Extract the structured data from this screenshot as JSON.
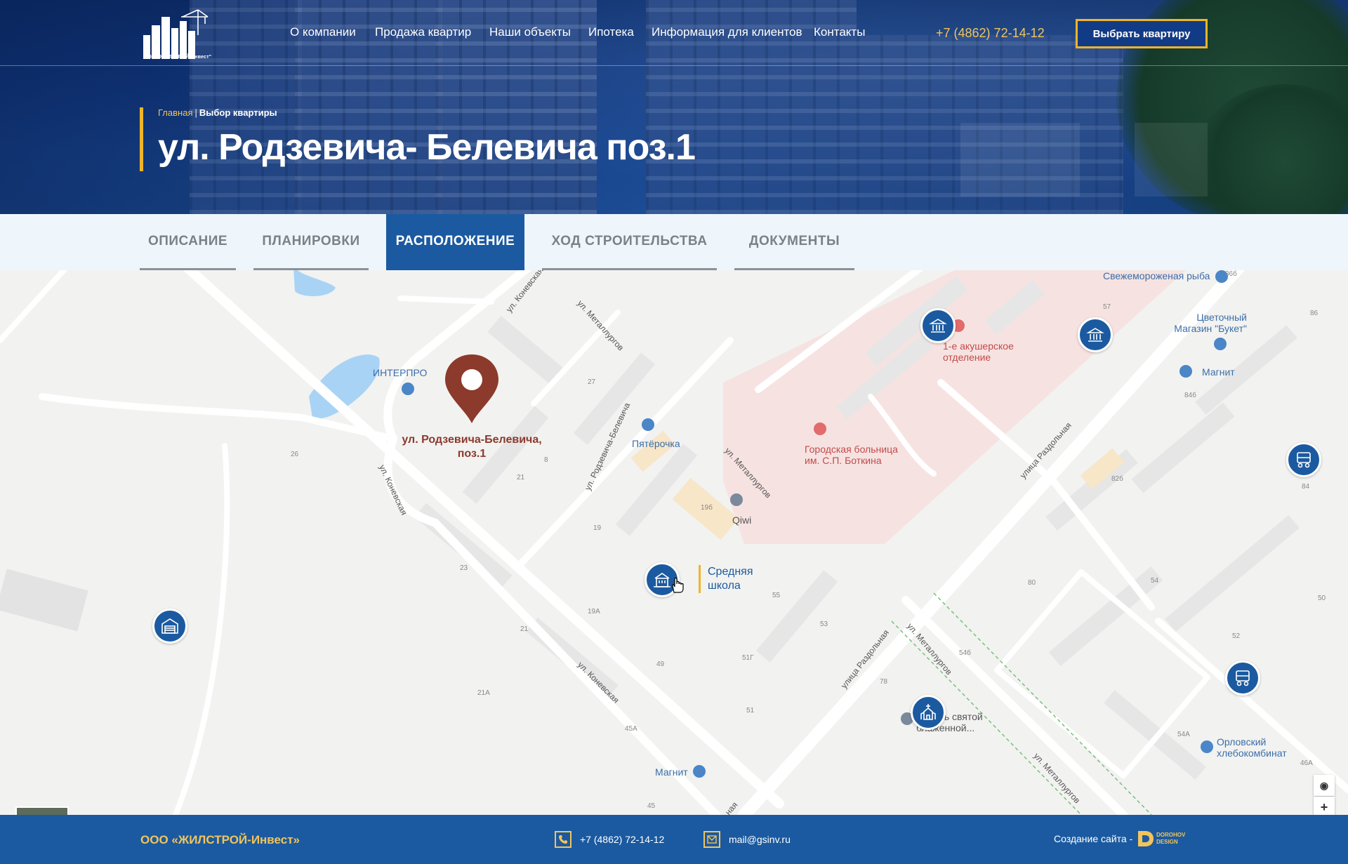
{
  "header": {
    "logo_text": "ООО \"ЖИЛСТРОЙ-Инвест\"",
    "nav": [
      "О компании",
      "Продажа квартир",
      "Наши объекты",
      "Ипотека",
      "Информация для клиентов",
      "Контакты"
    ],
    "phone": "+7 (4862) 72-14-12",
    "cta_label": "Выбрать квартиру"
  },
  "breadcrumb": {
    "home": "Главная",
    "separator": "|",
    "current": "Выбор квартиры"
  },
  "page_title": "ул. Родзевича- Белевича поз.1",
  "tabs": [
    {
      "label": "ОПИСАНИЕ",
      "active": false
    },
    {
      "label": "ПЛАНИРОВКИ",
      "active": false
    },
    {
      "label": "РАСПОЛОЖЕНИЕ",
      "active": true
    },
    {
      "label": "ХОД СТРОИТЕЛЬСТВА",
      "active": false
    },
    {
      "label": "ДОКУМЕНТЫ",
      "active": false
    }
  ],
  "map": {
    "main_marker_label": "ул. Родзевича-Белевича, поз.1",
    "school_label": "Средняя школа",
    "pois": {
      "interpro": "ИНТЕРПРО",
      "pyaterochka": "Пятёрочка",
      "qiwi": "Qiwi",
      "hospital": "Городская больница им. С.П. Боткина",
      "maternity": "1-е акушерское отделение",
      "fish": "Свежемороженая рыба",
      "flowers": "Цветочный Магазин \"Букет\"",
      "magnit_top": "Магнит",
      "magnit_bottom": "Магнит",
      "church": "в честь святой блаженной...",
      "bakery": "Орловский хлебокомбинат"
    },
    "streets": {
      "konevskaya_1": "ул. Коневская",
      "konevskaya_2": "ул. Коневская",
      "konevskaya_3": "ул. Коневская",
      "metallurgov_1": "ул. Металлургов",
      "metallurgov_2": "ул. Металлургов",
      "metallurgov_3": "ул. Металлургов",
      "metallurgov_4": "ул. Металлургов",
      "rodzevicha": "ул. Родзевича-Белевича",
      "razdolnaya_1": "улица Раздольная",
      "razdolnaya_2": "улица Раздольная",
      "razdolnaya_3": "ная"
    },
    "house_numbers": {
      "h26": "26",
      "h27": "27",
      "h21": "21",
      "h8": "8",
      "h19": "19",
      "h23": "23",
      "h19A": "19А",
      "h21b": "21",
      "h49": "49",
      "h21A": "21А",
      "h45A": "45А",
      "h45": "45",
      "h19b": "19б",
      "h55": "55",
      "h53": "53",
      "h51G": "51Г",
      "h51": "51",
      "h57": "57",
      "h86b": "86б",
      "h86": "86",
      "h84b": "84б",
      "h82b": "82б",
      "h84": "84",
      "h80": "80",
      "h54": "54",
      "h50": "50",
      "h52": "52",
      "h54b": "54б",
      "h78": "78",
      "h54A": "54А",
      "h46A": "46А"
    },
    "zoom_in": "+",
    "locate": "◉"
  },
  "footer": {
    "company": "ООО «ЖИЛСТРОЙ-Инвест»",
    "phone": "+7 (4862) 72-14-12",
    "email": "mail@gsinv.ru",
    "made_by": "Создание сайта -",
    "studio_line1": "DOROHOV",
    "studio_line2": "DESIGN"
  },
  "colors": {
    "accent": "#f0b429",
    "brand_blue": "#1b5aa0",
    "marker": "#8b3a2b"
  },
  "icons": [
    "logo-buildings-icon",
    "bank-icon",
    "school-icon",
    "garage-icon",
    "train-icon",
    "church-icon",
    "phone-icon",
    "mail-icon",
    "map-pin-icon",
    "hospital-icon",
    "cart-icon",
    "shop-icon"
  ]
}
